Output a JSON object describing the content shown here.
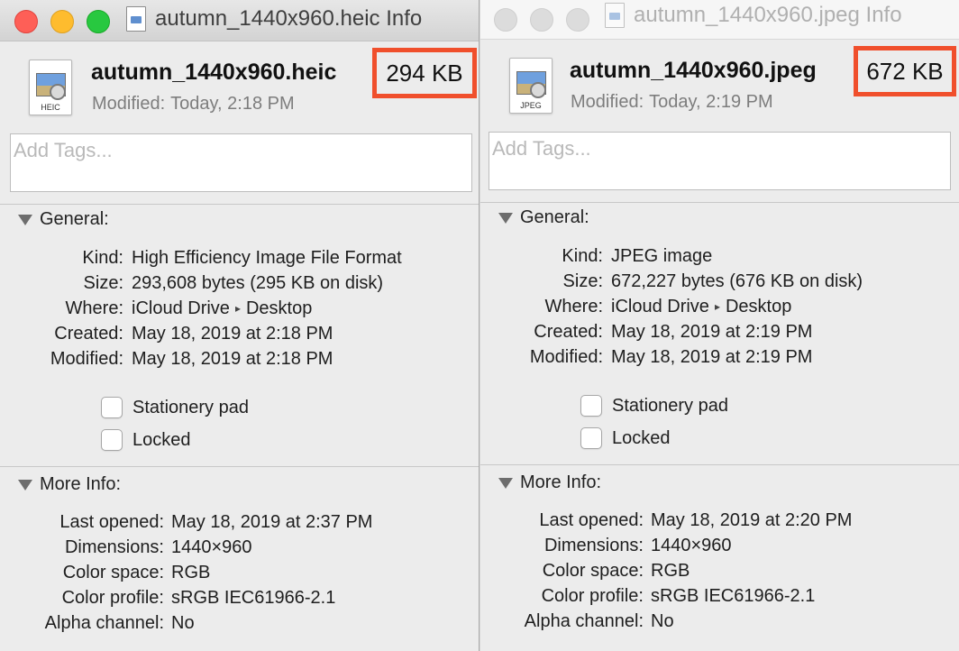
{
  "windows": [
    {
      "title": "autumn_1440x960.heic Info",
      "file_name": "autumn_1440x960.heic",
      "file_size": "294 KB",
      "icon_ext": "HEIC",
      "modified_label": "Modified:",
      "modified_value": "Today, 2:18 PM",
      "tags_placeholder": "Add Tags...",
      "general": {
        "title": "General:",
        "kind_label": "Kind:",
        "kind": "High Efficiency Image File Format",
        "size_label": "Size:",
        "size": "293,608 bytes (295 KB on disk)",
        "where_label": "Where:",
        "where_a": "iCloud Drive",
        "where_sep": "▸",
        "where_b": "Desktop",
        "created_label": "Created:",
        "created": "May 18, 2019 at 2:18 PM",
        "modified_label": "Modified:",
        "modified": "May 18, 2019 at 2:18 PM",
        "stationery": "Stationery pad",
        "locked": "Locked"
      },
      "more": {
        "title": "More Info:",
        "last_opened_label": "Last opened:",
        "last_opened": "May 18, 2019 at 2:37 PM",
        "dimensions_label": "Dimensions:",
        "dimensions": "1440×960",
        "color_space_label": "Color space:",
        "color_space": "RGB",
        "color_profile_label": "Color profile:",
        "color_profile": "sRGB IEC61966-2.1",
        "alpha_label": "Alpha channel:",
        "alpha": "No"
      }
    },
    {
      "title": "autumn_1440x960.jpeg Info",
      "file_name": "autumn_1440x960.jpeg",
      "file_size": "672 KB",
      "icon_ext": "JPEG",
      "modified_label": "Modified:",
      "modified_value": "Today, 2:19 PM",
      "tags_placeholder": "Add Tags...",
      "general": {
        "title": "General:",
        "kind_label": "Kind:",
        "kind": "JPEG image",
        "size_label": "Size:",
        "size": "672,227 bytes (676 KB on disk)",
        "where_label": "Where:",
        "where_a": "iCloud Drive",
        "where_sep": "▸",
        "where_b": "Desktop",
        "created_label": "Created:",
        "created": "May 18, 2019 at 2:19 PM",
        "modified_label": "Modified:",
        "modified": "May 18, 2019 at 2:19 PM",
        "stationery": "Stationery pad",
        "locked": "Locked"
      },
      "more": {
        "title": "More Info:",
        "last_opened_label": "Last opened:",
        "last_opened": "May 18, 2019 at 2:20 PM",
        "dimensions_label": "Dimensions:",
        "dimensions": "1440×960",
        "color_space_label": "Color space:",
        "color_space": "RGB",
        "color_profile_label": "Color profile:",
        "color_profile": "sRGB IEC61966-2.1",
        "alpha_label": "Alpha channel:",
        "alpha": "No"
      }
    }
  ],
  "colors": {
    "highlight_border": "#f04f2c",
    "close": "#fe5f57",
    "minimize": "#febc2e",
    "zoom": "#28c840"
  }
}
